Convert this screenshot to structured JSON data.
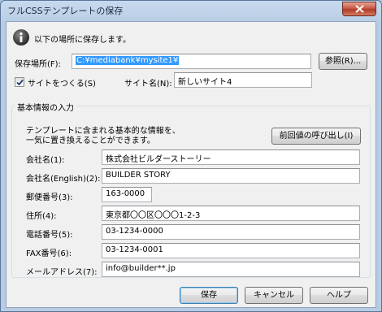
{
  "window": {
    "title": "フルCSSテンプレートの保存"
  },
  "info": {
    "message": "以下の場所に保存します。"
  },
  "location": {
    "label": "保存場所(F):",
    "path": "C:¥mediabank¥mysite1¥",
    "browse_button": "参照(R)..."
  },
  "site": {
    "create_label": "サイトをつくる(S)",
    "create_checked": true,
    "name_label": "サイト名(N):",
    "name_value": "新しいサイト4"
  },
  "basic_info": {
    "group_label": "基本情報の入力",
    "description_line1": "テンプレートに含まれる基本的な情報を、",
    "description_line2": "一気に置き換えることができます。",
    "recall_button": "前回値の呼び出し(I)",
    "fields": [
      {
        "label": "会社名(1):",
        "value": "株式会社ビルダーストーリー"
      },
      {
        "label": "会社名(English)(2):",
        "value": "BUILDER STORY"
      },
      {
        "label": "郵便番号(3):",
        "value": "163-0000"
      },
      {
        "label": "住所(4):",
        "value": "東京都〇〇区〇〇〇1-2-3"
      },
      {
        "label": "電話番号(5):",
        "value": "03-1234-0000"
      },
      {
        "label": "FAX番号(6):",
        "value": "03-1234-0001"
      },
      {
        "label": "メールアドレス(7):",
        "value": "info@builder**.jp"
      }
    ]
  },
  "buttons": {
    "save": "保存",
    "cancel": "キャンセル",
    "help": "ヘルプ"
  }
}
